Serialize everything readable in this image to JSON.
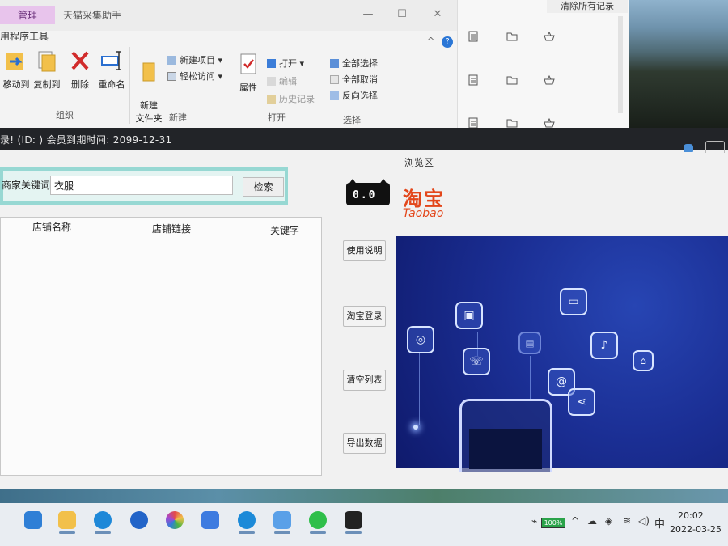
{
  "explorer": {
    "manage_tab": "管理",
    "window_title": "天猫采集助手",
    "tools_tab": "用程序工具",
    "min_glyph": "—",
    "max_glyph": "☐",
    "close_glyph": "✕",
    "help_glyph": "?",
    "collapse_glyph": "^",
    "groups": {
      "organize": {
        "label": "组织",
        "move_to": "移动到",
        "copy_to": "复制到",
        "delete": "删除",
        "rename": "重命名"
      },
      "new": {
        "label": "新建",
        "new_folder": "新建\n文件夹",
        "new_item": "新建项目",
        "easy_access": "轻松访问"
      },
      "open": {
        "label": "打开",
        "properties": "属性",
        "open": "打开",
        "edit": "编辑",
        "history": "历史记录"
      },
      "select": {
        "label": "选择",
        "select_all": "全部选择",
        "select_none": "全部取消",
        "invert": "反向选择"
      }
    }
  },
  "recent": {
    "clear_all": "清除所有记录"
  },
  "app": {
    "status_bar": "录! (ID: ) 会员到期时间: 2099-12-31",
    "browse_area": "浏览区",
    "search": {
      "label": "商家关键词",
      "value": "衣服",
      "button": "检索"
    },
    "table": {
      "columns": [
        "店铺名称",
        "店铺链接",
        "关键字"
      ],
      "rows": []
    },
    "buttons": {
      "usage": "使用说明",
      "login": "淘宝登录",
      "clear": "清空列表",
      "export": "导出数据"
    },
    "brand": {
      "tmall_face": "0.0",
      "taobao_cn": "淘宝",
      "taobao_en": "Taobao",
      "color": "#e3471b"
    },
    "banner_icons": [
      "gamepad-icon",
      "briefcase-icon",
      "phone-icon",
      "tv-icon",
      "image-icon",
      "microphone-icon",
      "hanger-icon",
      "at-icon",
      "share-icon"
    ]
  },
  "taskbar": {
    "apps": [
      "mail-icon",
      "explorer-icon",
      "edge-icon",
      "l-app-icon",
      "photos-icon",
      "feishu-icon",
      "qq-browser-icon",
      "network-app-icon",
      "wechat-icon",
      "taobao-helper-icon"
    ],
    "battery": "100%",
    "tray_caret": "^",
    "ime": "中",
    "time": "20:02",
    "date": "2022-03-25"
  }
}
